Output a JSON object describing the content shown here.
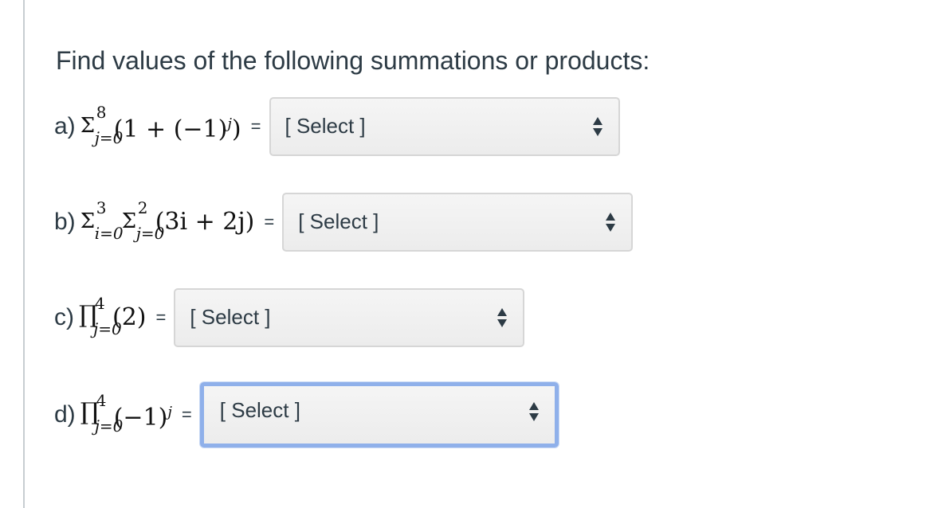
{
  "prompt": "Find values of the following summations or products:",
  "questions": [
    {
      "label": "a)",
      "operators": [
        {
          "symbol": "Σ",
          "upper": "8",
          "lower": "j=0"
        }
      ],
      "term": "(1 + (−1)",
      "term_sup": "j",
      "term_tail": ")",
      "equals": "=",
      "select": {
        "value": "[ Select ]",
        "focused": false
      }
    },
    {
      "label": "b)",
      "operators": [
        {
          "symbol": "Σ",
          "upper": "3",
          "lower": "i=0"
        },
        {
          "symbol": "Σ",
          "upper": "2",
          "lower": "j=0"
        }
      ],
      "term": "(3i + 2j)",
      "term_sup": "",
      "term_tail": "",
      "equals": "=",
      "select": {
        "value": "[ Select ]",
        "focused": false
      }
    },
    {
      "label": "c)",
      "operators": [
        {
          "symbol": "∏",
          "upper": "4",
          "lower": "j=0"
        }
      ],
      "term": "(2)",
      "term_sup": "",
      "term_tail": "",
      "equals": "=",
      "select": {
        "value": "[ Select ]",
        "focused": false
      }
    },
    {
      "label": "d)",
      "operators": [
        {
          "symbol": "∏",
          "upper": "4",
          "lower": "j=0"
        }
      ],
      "term": "(−1)",
      "term_sup": "j",
      "term_tail": "",
      "equals": "=",
      "select": {
        "value": "[ Select ]",
        "focused": true
      }
    }
  ],
  "colors": {
    "text": "#2d3b45",
    "select_bg": "#f5f5f5",
    "select_border": "#d6d6d6",
    "focus_border": "#8fb0ea"
  },
  "icons": {
    "select_arrows": "up-down-arrows-icon"
  }
}
